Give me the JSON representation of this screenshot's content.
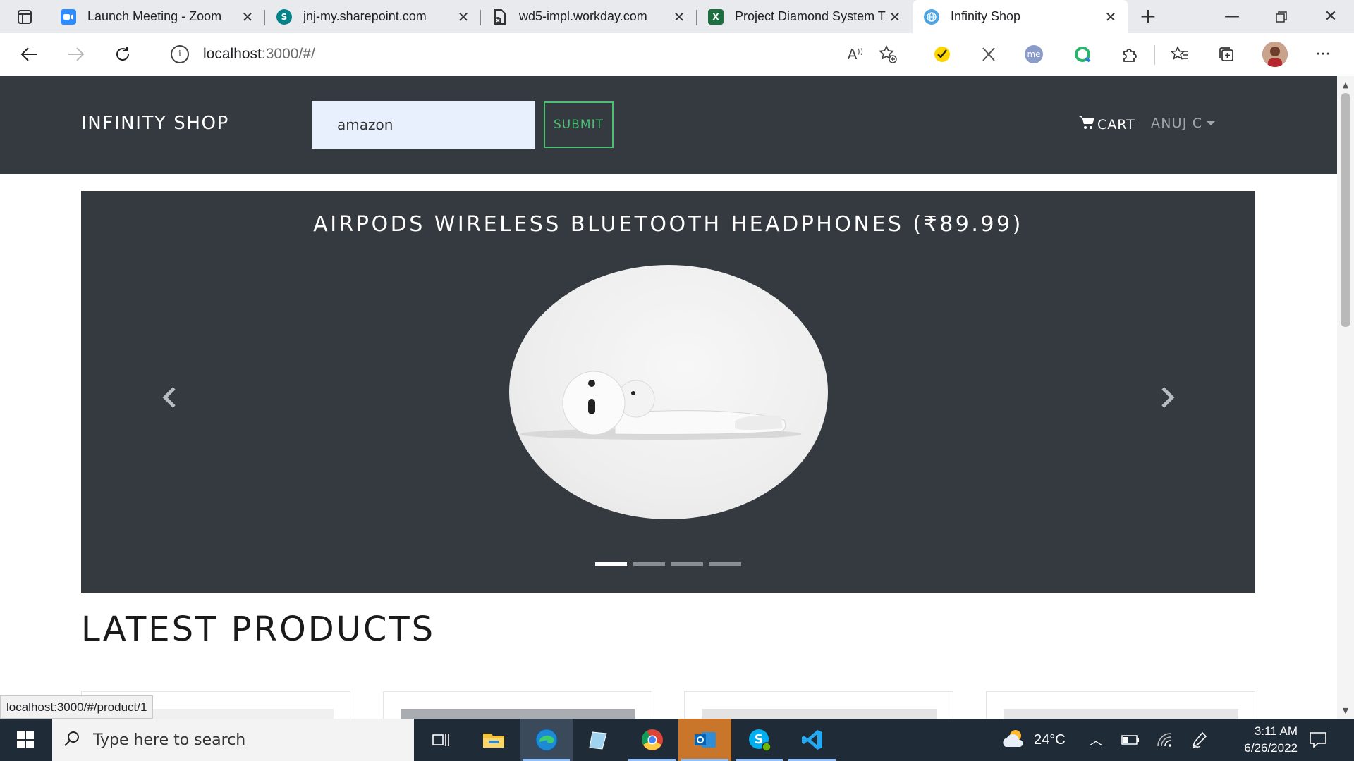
{
  "browser": {
    "tabs": [
      {
        "title": "Launch Meeting - Zoom",
        "icon": "zoom-icon",
        "color": "#2d8cff"
      },
      {
        "title": "jnj-my.sharepoint.com",
        "icon": "sharepoint-icon",
        "color": "#038387"
      },
      {
        "title": "wd5-impl.workday.com",
        "icon": "document-blocked-icon",
        "color": "#444444"
      },
      {
        "title": "Project Diamond System T",
        "icon": "excel-icon",
        "color": "#1d6f42"
      },
      {
        "title": "Infinity Shop",
        "icon": "globe-icon",
        "color": "#4fa3e0"
      }
    ],
    "address": {
      "host": "localhost",
      "path": ":3000/#/"
    }
  },
  "navbar": {
    "brand": "INFINITY SHOP",
    "search_value": "amazon",
    "submit_label": "SUBMIT",
    "cart_label": "CART",
    "user_label": "ANUJ C"
  },
  "carousel": {
    "caption": "AIRPODS WIRELESS BLUETOOTH HEADPHONES (₹89.99)",
    "slide_count": 4,
    "active_index": 0
  },
  "main": {
    "section_title": "LATEST PRODUCTS"
  },
  "status_bar": {
    "url": "localhost:3000/#/product/1"
  },
  "taskbar": {
    "search_placeholder": "Type here to search",
    "weather": "24°C",
    "time": "3:11 AM",
    "date": "6/26/2022"
  },
  "colors": {
    "navbar_bg": "#343a40",
    "success_green": "#4bbf73",
    "taskbar_bg": "#202b38"
  }
}
